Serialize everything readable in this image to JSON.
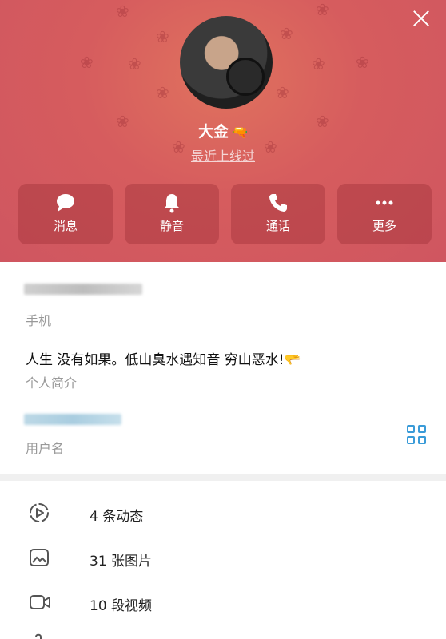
{
  "profile": {
    "name": "大金",
    "status": "最近上线过"
  },
  "actions": [
    {
      "label": "消息",
      "icon": "chat-bubble-icon"
    },
    {
      "label": "静音",
      "icon": "bell-icon"
    },
    {
      "label": "通话",
      "icon": "phone-icon"
    },
    {
      "label": "更多",
      "icon": "more-dots-icon"
    }
  ],
  "info": {
    "phone_label": "手机",
    "bio_text": "人生 没有如果。低山臭水遇知音 穷山恶水!",
    "bio_label": "个人简介",
    "username_label": "用户名"
  },
  "media": [
    {
      "text": "4 条动态",
      "icon": "stories-icon"
    },
    {
      "text": "31 张图片",
      "icon": "image-icon"
    },
    {
      "text": "10 段视频",
      "icon": "video-icon"
    }
  ],
  "colors": {
    "header": "#d65c5e",
    "accent": "#3a9bd8"
  }
}
